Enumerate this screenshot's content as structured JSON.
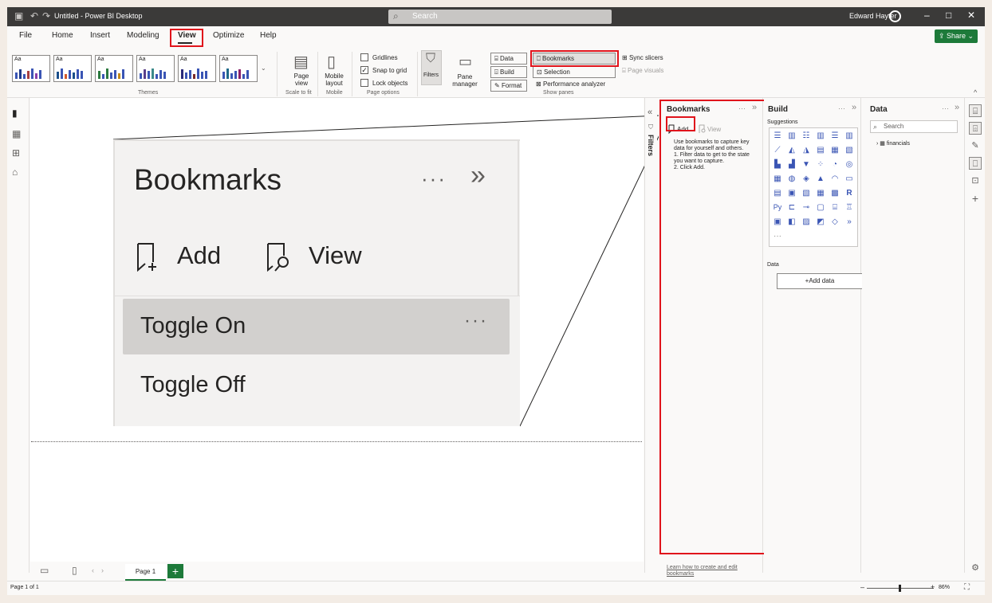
{
  "titlebar": {
    "title": "Untitled - Power BI Desktop",
    "search_placeholder": "Search",
    "user_name": "Edward Hayter"
  },
  "menu": {
    "items": [
      "File",
      "Home",
      "Insert",
      "Modeling",
      "View",
      "Optimize",
      "Help"
    ],
    "active": "View",
    "share_label": "Share"
  },
  "ribbon": {
    "theme_label": "Aa",
    "themes_group": "Themes",
    "page_view": "Page view",
    "scale_group": "Scale to fit",
    "mobile_layout": "Mobile layout",
    "mobile_group": "Mobile",
    "gridlines": "Gridlines",
    "snap_to_grid": "Snap to grid",
    "lock_objects": "Lock objects",
    "page_options_group": "Page options",
    "filters": "Filters",
    "pane_manager": "Pane manager",
    "data_btn": "Data",
    "build_btn": "Build",
    "format_btn": "Format",
    "bookmarks_btn": "Bookmarks",
    "selection_btn": "Selection",
    "perf_btn": "Performance analyzer",
    "sync_slicers": "Sync slicers",
    "page_visuals": "Page visuals",
    "show_panes_group": "Show panes"
  },
  "zoom": {
    "title": "Bookmarks",
    "more": "···",
    "add": "Add",
    "view": "View",
    "toggle_on": "Toggle On",
    "toggle_off": "Toggle Off"
  },
  "filters_label": "Filters",
  "bookmarks_pane": {
    "title": "Bookmarks",
    "add": "Add",
    "view": "View",
    "desc1": "Use bookmarks to capture key data for yourself and others.",
    "desc2": "1. Filter data to get to the state you want to capture.",
    "desc3": "2. Click Add.",
    "learn": "Learn how to create and edit bookmarks"
  },
  "build_pane": {
    "title": "Build",
    "suggestions": "Suggestions",
    "data_label": "Data",
    "add_data": "+Add data"
  },
  "data_pane": {
    "title": "Data",
    "search": "Search",
    "table": "financials"
  },
  "pages": {
    "tab": "Page 1"
  },
  "status": {
    "page_count": "Page 1 of 1",
    "zoom": "86%"
  },
  "colors": {
    "accent_green": "#1d7a3a",
    "highlight_red": "#e0131b",
    "titlebar": "#3b3a39"
  }
}
